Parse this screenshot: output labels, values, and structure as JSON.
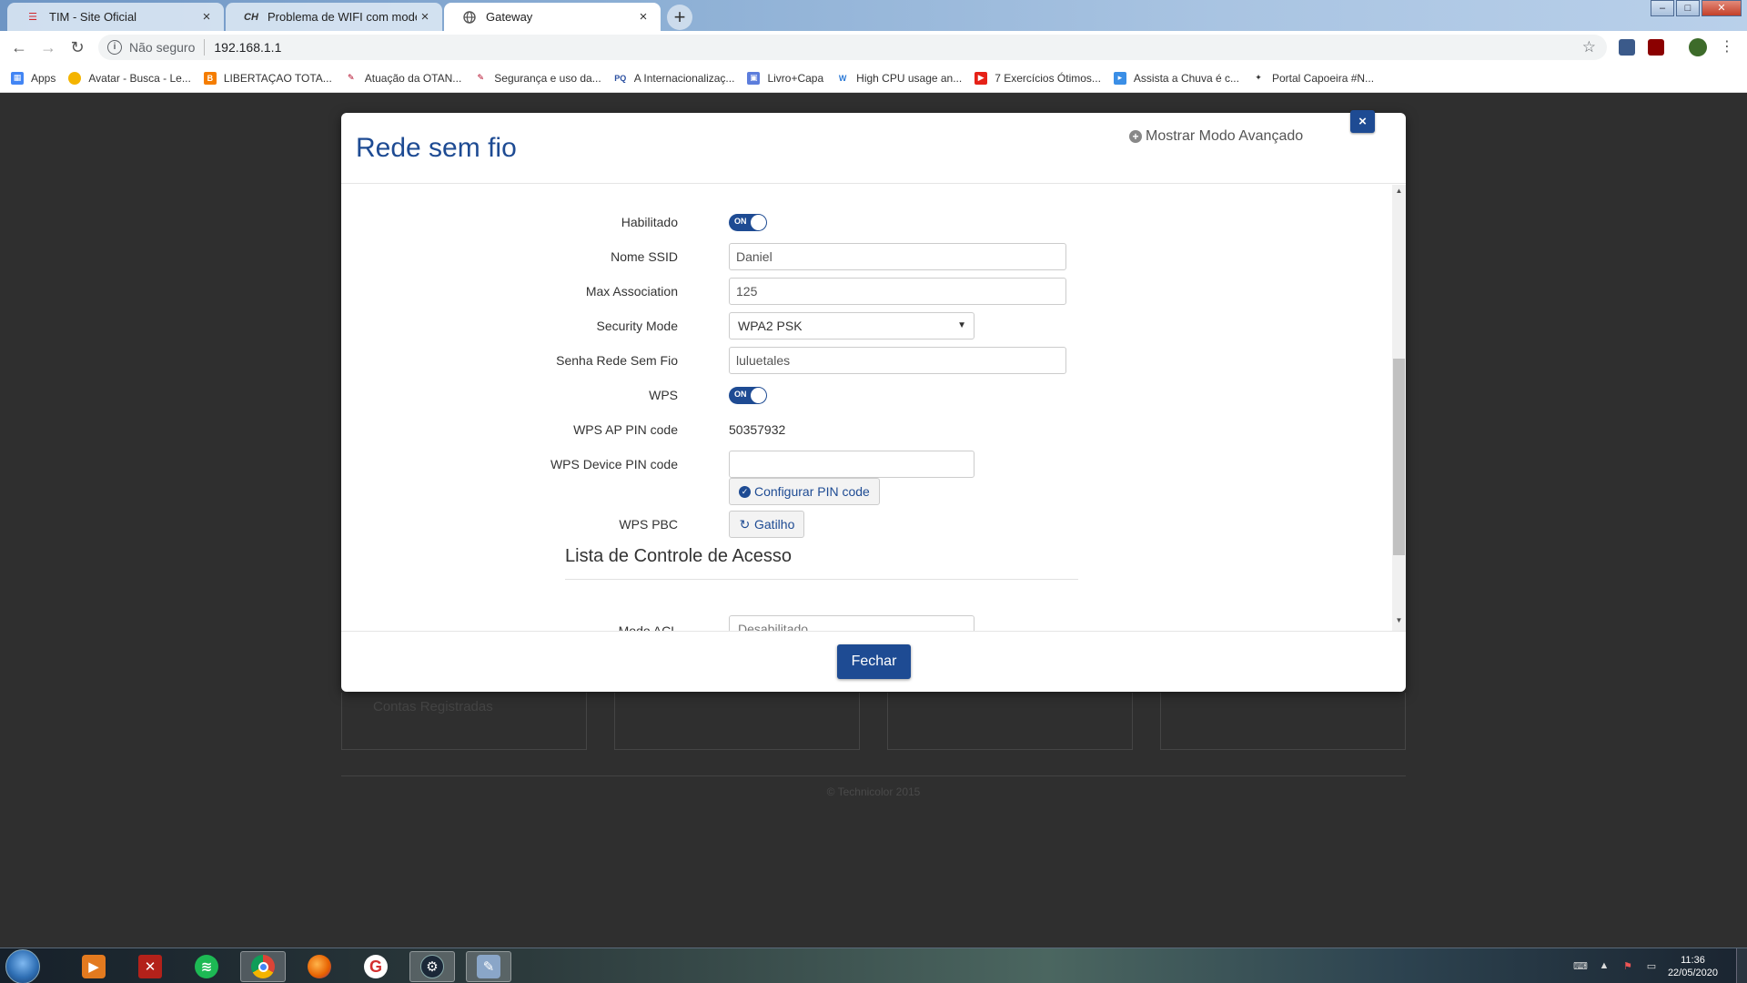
{
  "browser": {
    "tabs": [
      {
        "title": "TIM - Site Oficial",
        "icon": "tim-logo-icon",
        "active": false
      },
      {
        "title": "Problema de WIFI com modem T",
        "icon": "clube-hardware-icon",
        "active": false
      },
      {
        "title": "Gateway",
        "icon": "globe-icon",
        "active": true
      }
    ],
    "url_security": "Não seguro",
    "url": "192.168.1.1",
    "bookmarks": [
      {
        "label": "Apps",
        "icon": "apps-grid-icon",
        "color": "#4285f4"
      },
      {
        "label": "Avatar - Busca - Le...",
        "icon": "avatar-icon",
        "color": "#f4b400"
      },
      {
        "label": "LIBERTAÇAO TOTA...",
        "icon": "blogger-icon",
        "color": "#f57d00"
      },
      {
        "label": "Atuação da OTAN...",
        "icon": "feather-icon",
        "color": "#b00020"
      },
      {
        "label": "Segurança e uso da...",
        "icon": "feather-icon",
        "color": "#b00020"
      },
      {
        "label": "A Internacionalizaç...",
        "icon": "pq-icon",
        "color": "#2a4fa0"
      },
      {
        "label": "Livro+Capa",
        "icon": "book-icon",
        "color": "#5c7ddc"
      },
      {
        "label": "High CPU usage an...",
        "icon": "w-logo-icon",
        "color": "#2b79d6"
      },
      {
        "label": "7 Exercícios Ótimos...",
        "icon": "youtube-icon",
        "color": "#e62117"
      },
      {
        "label": "Assista a Chuva é c...",
        "icon": "play-icon",
        "color": "#3a8ee6"
      },
      {
        "label": "Portal Capoeira #N...",
        "icon": "capoeira-icon",
        "color": "#333333"
      }
    ]
  },
  "background": {
    "card_text": "Contas Registradas",
    "footer": "© Technicolor 2015"
  },
  "modal": {
    "title": "Rede sem fio",
    "advanced_link": "Mostrar Modo Avançado",
    "close_glyph": "×",
    "fields": {
      "enabled_label": "Habilitado",
      "enabled_state": "ON",
      "ssid_label": "Nome SSID",
      "ssid_value": "Daniel",
      "max_assoc_label": "Max Association",
      "max_assoc_value": "125",
      "security_label": "Security Mode",
      "security_value": "WPA2 PSK",
      "password_label": "Senha Rede Sem Fio",
      "password_value": "luluetales",
      "wps_label": "WPS",
      "wps_state": "ON",
      "wps_pin_label": "WPS AP PIN code",
      "wps_pin_value": "50357932",
      "wps_device_label": "WPS Device PIN code",
      "wps_device_value": "",
      "configure_pin_button": "Configurar PIN code",
      "wps_pbc_label": "WPS PBC",
      "trigger_button": "Gatilho"
    },
    "section_title": "Lista de Controle de Acesso",
    "acl_label": "Modo ACL",
    "acl_value": "Desabilitado",
    "close_button": "Fechar"
  },
  "taskbar": {
    "apps": [
      {
        "name": "media-player-icon",
        "color": "#e37a1f"
      },
      {
        "name": "dota-icon",
        "color": "#b3211a"
      },
      {
        "name": "spotify-icon",
        "color": "#1db954"
      },
      {
        "name": "chrome-icon",
        "color": "#db4437"
      },
      {
        "name": "firefox-icon",
        "color": "#e66000"
      },
      {
        "name": "g-app-icon",
        "color": "#d32f2f"
      },
      {
        "name": "steam-icon",
        "color": "#1b2838"
      },
      {
        "name": "paint-icon",
        "color": "#8aa6c8"
      }
    ],
    "time": "11:36",
    "date": "22/05/2020"
  }
}
